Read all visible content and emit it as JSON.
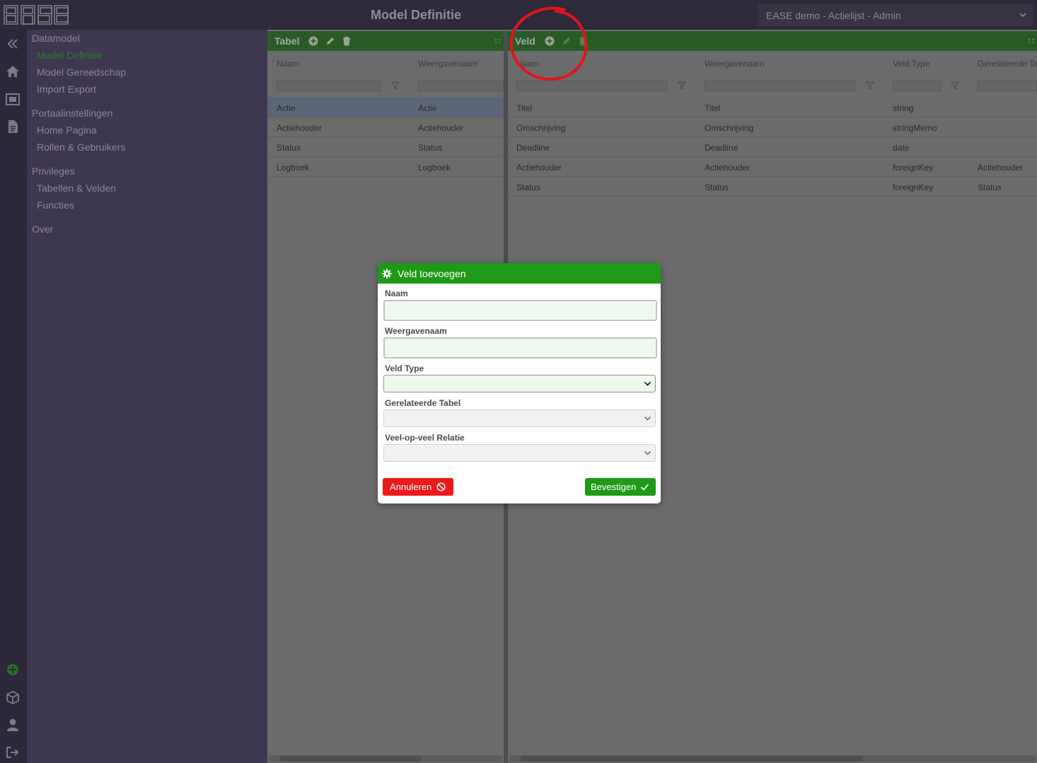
{
  "header": {
    "logo_text": "EASE",
    "title": "Model Definitie",
    "environment": "EASE demo - Actielijst - Admin"
  },
  "sidebar": {
    "groups": [
      {
        "label": "Datamodel",
        "items": [
          {
            "label": "Model Definitie",
            "active": true
          },
          {
            "label": "Model Gereedschap",
            "active": false
          },
          {
            "label": "Import Export",
            "active": false
          }
        ]
      },
      {
        "label": "Portaalinstellingen",
        "items": [
          {
            "label": "Home Pagina",
            "active": false
          },
          {
            "label": "Rollen & Gebruikers",
            "active": false
          }
        ]
      },
      {
        "label": "Privileges",
        "items": [
          {
            "label": "Tabellen & Velden",
            "active": false
          },
          {
            "label": "Functies",
            "active": false
          }
        ]
      },
      {
        "label": "Over",
        "items": []
      }
    ],
    "rail_icons": [
      "collapse-icon",
      "home-icon",
      "image-icon",
      "document-icon",
      "plus-circle-icon",
      "cube-icon",
      "user-icon",
      "logout-icon"
    ]
  },
  "tabel_panel": {
    "title": "Tabel",
    "columns": [
      "Naam",
      "Weergavenaam"
    ],
    "rows": [
      {
        "naam": "Actie",
        "weergavenaam": "Actie",
        "selected": true
      },
      {
        "naam": "Actiehouder",
        "weergavenaam": "Actiehouder",
        "selected": false
      },
      {
        "naam": "Status",
        "weergavenaam": "Status",
        "selected": false
      },
      {
        "naam": "Logboek",
        "weergavenaam": "Logboek",
        "selected": false
      }
    ]
  },
  "veld_panel": {
    "title": "Veld",
    "columns": [
      "Naam",
      "Weergavenaam",
      "Veld Type",
      "Gerelateerde Ta"
    ],
    "rows": [
      {
        "naam": "Titel",
        "weergavenaam": "Titel",
        "type": "string",
        "relatie": ""
      },
      {
        "naam": "Omschrijving",
        "weergavenaam": "Omschrijving",
        "type": "stringMemo",
        "relatie": ""
      },
      {
        "naam": "Deadline",
        "weergavenaam": "Deadline",
        "type": "date",
        "relatie": ""
      },
      {
        "naam": "Actiehouder",
        "weergavenaam": "Actiehouder",
        "type": "foreignKey",
        "relatie": "Actiehouder"
      },
      {
        "naam": "Status",
        "weergavenaam": "Status",
        "type": "foreignKey",
        "relatie": "Status"
      }
    ]
  },
  "modal": {
    "title": "Veld toevoegen",
    "fields": {
      "naam": {
        "label": "Naam",
        "value": ""
      },
      "weergavenaam": {
        "label": "Weergavenaam",
        "value": ""
      },
      "veld_type": {
        "label": "Veld Type",
        "value": ""
      },
      "gerelateerde_tabel": {
        "label": "Gerelateerde Tabel",
        "value": ""
      },
      "veel_op_veel": {
        "label": "Veel-op-veel Relatie",
        "value": ""
      }
    },
    "cancel_label": "Annuleren",
    "confirm_label": "Bevestigen"
  },
  "colors": {
    "accent_green": "#1f9a16",
    "cancel_red": "#ec1a1a",
    "annotation_red": "#e3141c",
    "sidebar_bg": "#3e3751"
  }
}
